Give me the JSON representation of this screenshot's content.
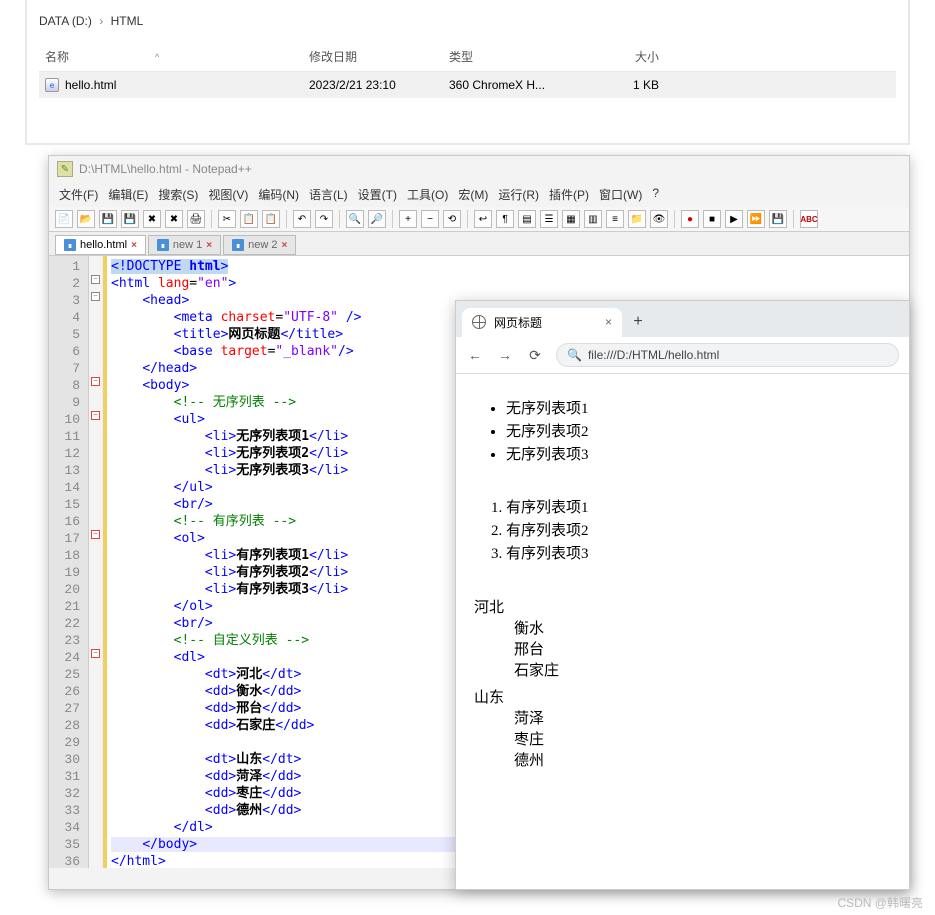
{
  "explorer": {
    "breadcrumb": {
      "root": "DATA (D:)",
      "folder": "HTML"
    },
    "columns": {
      "name": "名称",
      "date": "修改日期",
      "type": "类型",
      "size": "大小"
    },
    "row": {
      "name": "hello.html",
      "date": "2023/2/21 23:10",
      "type": "360 ChromeX H...",
      "size": "1 KB"
    }
  },
  "npp": {
    "title": "D:\\HTML\\hello.html - Notepad++",
    "menu": [
      "文件(F)",
      "编辑(E)",
      "搜索(S)",
      "视图(V)",
      "编码(N)",
      "语言(L)",
      "设置(T)",
      "工具(O)",
      "宏(M)",
      "运行(R)",
      "插件(P)",
      "窗口(W)",
      "?"
    ],
    "tabs": [
      {
        "label": "hello.html",
        "active": true
      },
      {
        "label": "new 1",
        "active": false
      },
      {
        "label": "new 2",
        "active": false
      }
    ],
    "code": {
      "lines": [
        "1",
        "2",
        "3",
        "4",
        "5",
        "6",
        "7",
        "8",
        "9",
        "10",
        "11",
        "12",
        "13",
        "14",
        "15",
        "16",
        "17",
        "18",
        "19",
        "20",
        "21",
        "22",
        "23",
        "24",
        "25",
        "26",
        "27",
        "28",
        "29",
        "30",
        "31",
        "32",
        "33",
        "34",
        "35",
        "36"
      ],
      "kw": {
        "doctype": "<!DOCTYPE",
        "doctype_kw": "html",
        "doctype_end": ">",
        "html_open": "<html",
        "lang": "lang",
        "en": "\"en\"",
        "close": ">",
        "head_open": "<head>",
        "meta": "<meta",
        "charset": "charset",
        "utf8": "\"UTF-8\"",
        "selfclose": "/>",
        "title_open": "<title>",
        "title_text": "网页标题",
        "title_close": "</title>",
        "base": "<base",
        "target": "target",
        "blank": "\"_blank\"",
        "head_close": "</head>",
        "body_open": "<body>",
        "ul_open": "<ul>",
        "ul_close": "</ul>",
        "ol_open": "<ol>",
        "ol_close": "</ol>",
        "li_open": "<li>",
        "li_close": "</li>",
        "br": "<br/>",
        "dl_open": "<dl>",
        "dl_close": "</dl>",
        "dt_open": "<dt>",
        "dt_close": "</dt>",
        "dd_open": "<dd>",
        "dd_close": "</dd>",
        "body_close": "</body>",
        "html_close": "</html>",
        "c1": "<!-- 无序列表 -->",
        "c2": "<!-- 有序列表 -->",
        "c3": "<!-- 自定义列表 -->"
      },
      "txt": {
        "u1": "无序列表项1",
        "u2": "无序列表项2",
        "u3": "无序列表项3",
        "o1": "有序列表项1",
        "o2": "有序列表项2",
        "o3": "有序列表项3",
        "p1": "河北",
        "p1a": "衡水",
        "p1b": "邢台",
        "p1c": "石家庄",
        "p2": "山东",
        "p2a": "菏泽",
        "p2b": "枣庄",
        "p2c": "德州"
      }
    }
  },
  "browser": {
    "tab_title": "网页标题",
    "url": "file:///D:/HTML/hello.html",
    "ul": [
      "无序列表项1",
      "无序列表项2",
      "无序列表项3"
    ],
    "ol": [
      "有序列表项1",
      "有序列表项2",
      "有序列表项3"
    ],
    "dl": [
      {
        "dt": "河北",
        "dd": [
          "衡水",
          "邢台",
          "石家庄"
        ]
      },
      {
        "dt": "山东",
        "dd": [
          "菏泽",
          "枣庄",
          "德州"
        ]
      }
    ]
  },
  "watermark": "CSDN @韩曙亮"
}
